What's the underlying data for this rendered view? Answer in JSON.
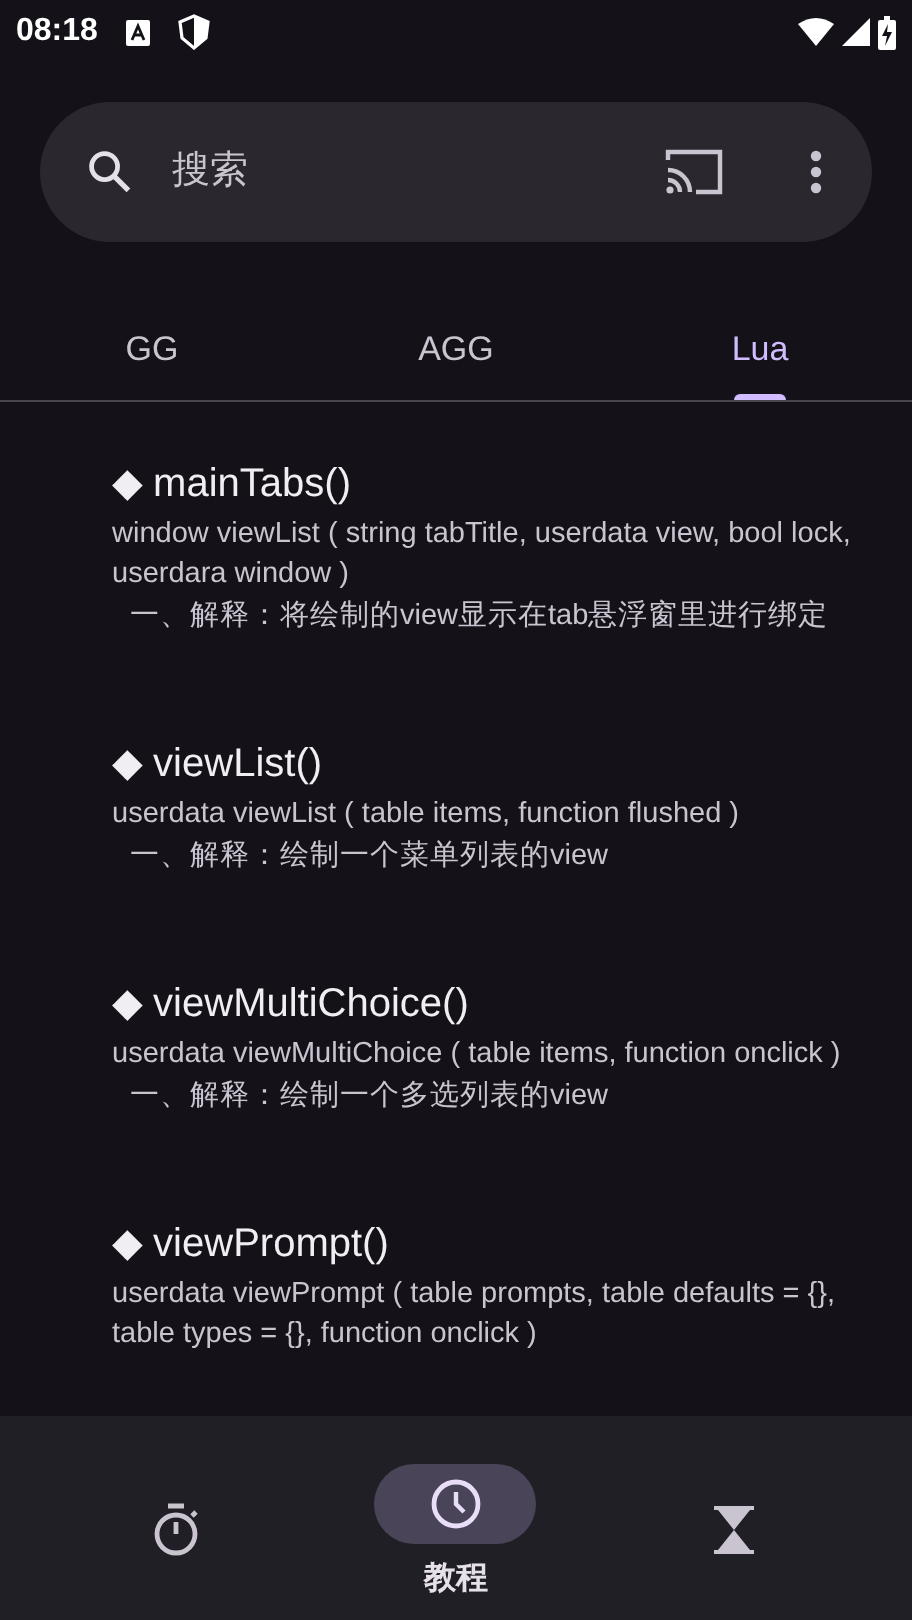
{
  "status_bar": {
    "time": "08:18"
  },
  "search": {
    "placeholder": "搜索"
  },
  "tabs": [
    {
      "label": "GG",
      "selected": false
    },
    {
      "label": "AGG",
      "selected": false
    },
    {
      "label": "Lua",
      "selected": true
    }
  ],
  "entries": [
    {
      "title": "◆ mainTabs()",
      "signature": "window viewList ( string tabTitle, userdata view, bool lock, userdara window )",
      "explanation": "一、解释：将绘制的view显示在tab悬浮窗里进行绑定"
    },
    {
      "title": "◆ viewList()",
      "signature": "userdata viewList ( table items, function flushed )",
      "explanation": "一、解释：绘制一个菜单列表的view"
    },
    {
      "title": "◆ viewMultiChoice()",
      "signature": "userdata viewMultiChoice ( table items, function onclick )",
      "explanation": "一、解释：绘制一个多选列表的view"
    },
    {
      "title": "◆ viewPrompt()",
      "signature": "userdata viewPrompt ( table prompts, table defaults = {}, table types = {}, function onclick )"
    }
  ],
  "bottom_nav": [
    {
      "kind": "stopwatch",
      "selected": false
    },
    {
      "kind": "clock",
      "selected": true,
      "label": "教程"
    },
    {
      "kind": "hourglass",
      "selected": false
    }
  ]
}
